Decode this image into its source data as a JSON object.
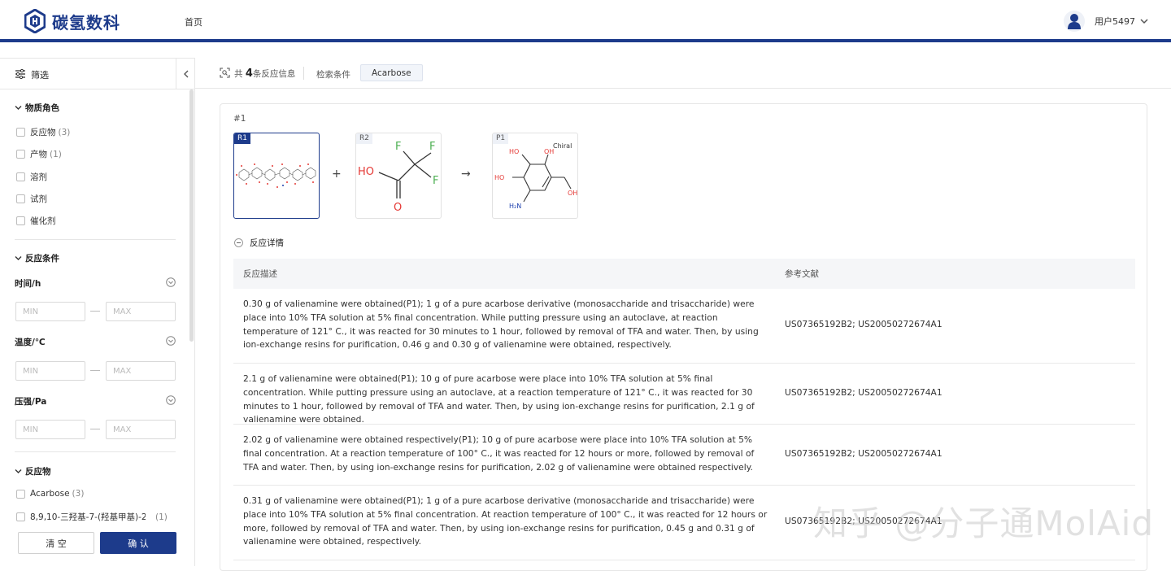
{
  "header": {
    "brand": "碳氢数科",
    "nav_home": "首页",
    "user_name": "用户5497"
  },
  "sidebar": {
    "title": "筛选",
    "role_section": "物质角色",
    "roles": [
      {
        "label": "反应物",
        "count": "(3)"
      },
      {
        "label": "产物",
        "count": "(1)"
      },
      {
        "label": "溶剂",
        "count": ""
      },
      {
        "label": "试剂",
        "count": ""
      },
      {
        "label": "催化剂",
        "count": ""
      }
    ],
    "cond_section": "反应条件",
    "conditions": [
      {
        "label": "时间/h",
        "min": "MIN",
        "max": "MAX"
      },
      {
        "label": "温度/℃",
        "min": "MIN",
        "max": "MAX"
      },
      {
        "label": "压强/Pa",
        "min": "MIN",
        "max": "MAX"
      }
    ],
    "reactant_section": "反应物",
    "reactants": [
      {
        "label": "Acarbose",
        "count": "(3)"
      },
      {
        "label": "8,9,10-三羟基-7-(羟基甲基)-2-...",
        "count": "(1)"
      }
    ],
    "clear_label": "清 空",
    "confirm_label": "确 认"
  },
  "result_bar": {
    "prefix": "共",
    "count": "4",
    "suffix": "条反应信息",
    "search_label": "检索条件",
    "search_tag": "Acarbose"
  },
  "reaction": {
    "index": "#1",
    "r1_tag": "R1",
    "r2_tag": "R2",
    "p1_tag": "P1",
    "plus": "+",
    "arrow": "→",
    "r2_atoms": {
      "f1": "F",
      "f2": "F",
      "f3": "F",
      "ho": "HO",
      "o": "O"
    },
    "p1_atoms": {
      "chiral": "Chiral",
      "oh1": "HO",
      "oh2": "OH",
      "oh3": "HO",
      "oh4": "OH",
      "nh2": "H₂N"
    },
    "detail_label": "反应详情",
    "table_headers": {
      "desc": "反应描述",
      "ref": "参考文献"
    },
    "rows": [
      {
        "desc": "0.30 g of valienamine were obtained(P1); 1 g of a pure acarbose derivative (monosaccharide and trisaccharide) were place into 10% TFA solution at 5% final concentration. While putting pressure using an autoclave, at reaction temperature of 121° C., it was reacted for 30 minutes to 1 hour, followed by removal of TFA and water. Then, by using ion-exchange resins for purification, 0.46 g and 0.30 g of valienamine were obtained, respectively.",
        "ref": "US07365192B2; US20050272674A1"
      },
      {
        "desc": "2.1 g of valienamine were obtained(P1); 10 g of pure acarbose were place into 10% TFA solution at 5% final concentration. While putting pressure using an autoclave, at a reaction temperature of 121° C., it was reacted for 30 minutes to 1 hour, followed by removal of TFA and water. Then, by using ion-exchange resins for purification, 2.1 g of valienamine were obtained.",
        "ref": "US07365192B2; US20050272674A1"
      },
      {
        "desc": "2.02 g of valienamine were obtained respectively(P1); 10 g of pure acarbose were place into 10% TFA solution at 5% final concentration. At a reaction temperature of 100° C., it was reacted for 12 hours or more, followed by removal of TFA and water. Then, by using ion-exchange resins for purification, 2.02 g of valienamine were obtained respectively.",
        "ref": "US07365192B2; US20050272674A1"
      },
      {
        "desc": "0.31 g of valienamine were obtained(P1); 1 g of a pure acarbose derivative (monosaccharide and trisaccharide) were place into 10% TFA solution at 5% final concentration. At reaction temperature of 100° C., it was reacted for 12 hours or more, followed by removal of TFA and water. Then, by using ion-exchange resins for purification, 0.45 g and 0.31 g of valienamine were obtained, respectively.",
        "ref": "US07365192B2; US20050272674A1"
      }
    ]
  },
  "watermark": "知乎 @分子通MolAid",
  "colors": {
    "brand": "#1d3b8b",
    "fluorine": "#4caf50",
    "oxygen": "#e53935",
    "nitrogen": "#1e40af"
  }
}
